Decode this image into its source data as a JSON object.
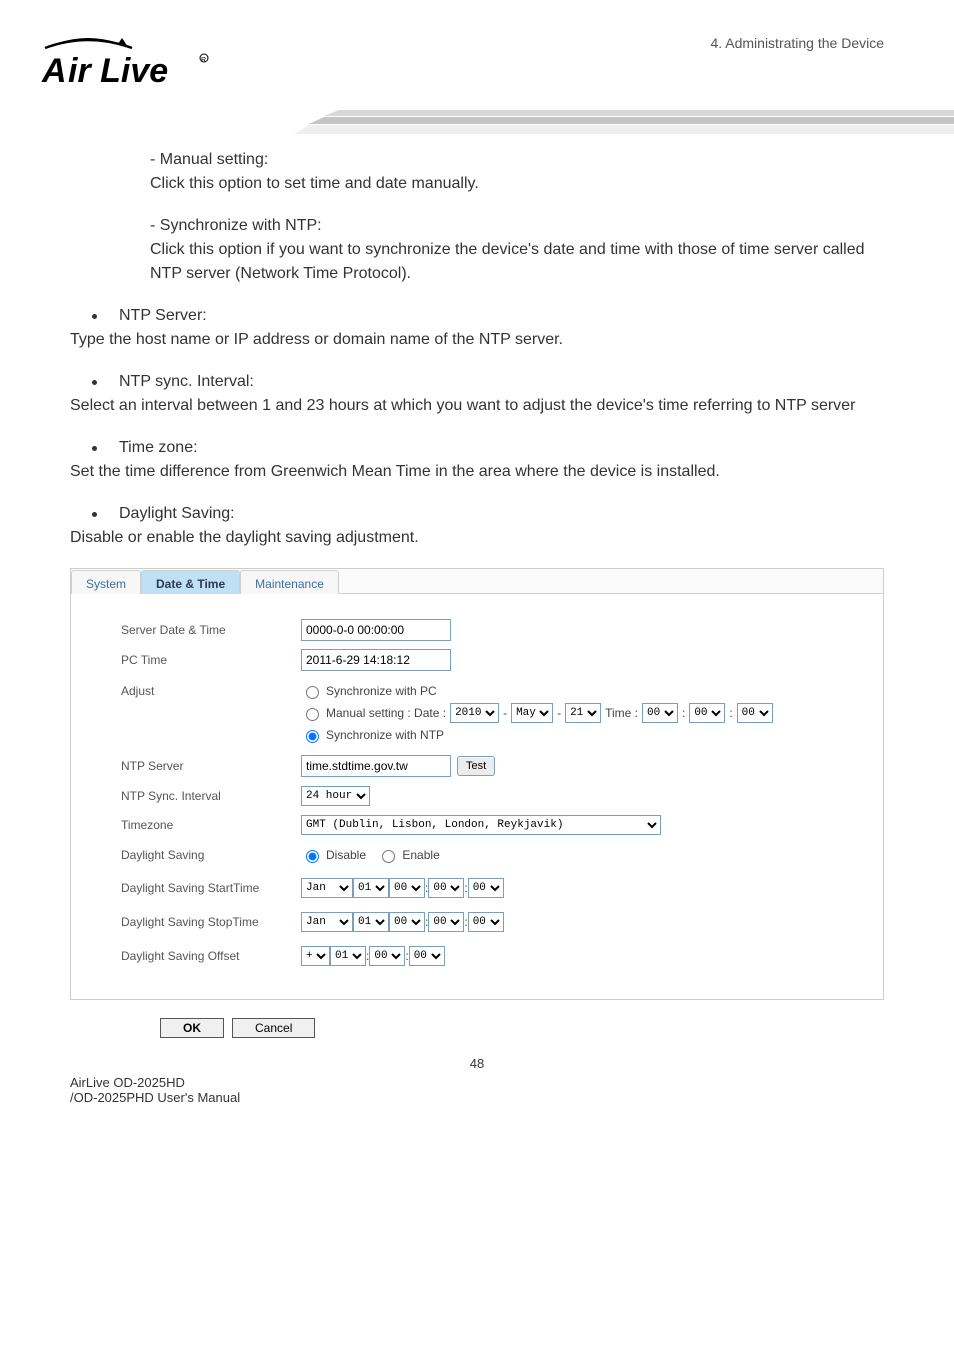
{
  "header": {
    "breadcrumb": "4.  Administrating  the  Device",
    "logo_text_main": "ir Live",
    "logo_text_a": "A"
  },
  "content": {
    "manual_title": "- Manual setting:",
    "manual_body": "Click this option to set time and date manually.",
    "sync_title": "- Synchronize with NTP:",
    "sync_body": "Click this option if you want to synchronize the device's date and time with those of time server called NTP server (Network Time Protocol).",
    "ntp_server_label": "NTP Server:",
    "ntp_server_body": "Type the host name or IP address or domain name of the NTP server.",
    "ntp_sync_label": "NTP sync. Interval:",
    "ntp_sync_body": "Select an interval between 1 and 23 hours at which you want to adjust the device's time referring to NTP server",
    "tz_label": "Time zone:",
    "tz_body": "Set the time difference from Greenwich Mean Time in the area where the device is installed.",
    "ds_label": "Daylight Saving:",
    "ds_body": "Disable or enable the daylight saving adjustment."
  },
  "panel": {
    "tabs": {
      "system": "System",
      "datetime": "Date & Time",
      "maintenance": "Maintenance"
    },
    "rows": {
      "server_dt_label": "Server Date & Time",
      "server_dt_value": "0000-0-0 00:00:00",
      "pc_time_label": "PC Time",
      "pc_time_value": "2011-6-29 14:18:12",
      "adjust_label": "Adjust",
      "adj_sync_pc": "Synchronize with PC",
      "adj_manual_prefix": "Manual setting : Date :",
      "adj_manual_year": "2010",
      "adj_manual_month": "May",
      "adj_manual_day": "21",
      "adj_manual_time_label": "Time :",
      "adj_manual_h": "00",
      "adj_manual_m": "00",
      "adj_manual_s": "00",
      "adj_sync_ntp": "Synchronize with NTP",
      "ntp_server_row_label": "NTP Server",
      "ntp_server_value": "time.stdtime.gov.tw",
      "test_btn": "Test",
      "ntp_sync_row_label": "NTP Sync. Interval",
      "ntp_sync_value": "24 hour",
      "tz_row_label": "Timezone",
      "tz_value": "GMT (Dublin, Lisbon, London, Reykjavik)",
      "ds_row_label": "Daylight Saving",
      "ds_disable": "Disable",
      "ds_enable": "Enable",
      "ds_start_label": "Daylight Saving StartTime",
      "ds_stop_label": "Daylight Saving StopTime",
      "ds_offset_label": "Daylight Saving Offset",
      "month_jan": "Jan",
      "day01": "01",
      "zero": "00",
      "plus": "+"
    },
    "buttons": {
      "ok": "OK",
      "cancel": "Cancel"
    }
  },
  "footer": {
    "page_num": "48",
    "line1": "AirLive OD-2025HD",
    "line2": "/OD-2025PHD User's Manual"
  }
}
